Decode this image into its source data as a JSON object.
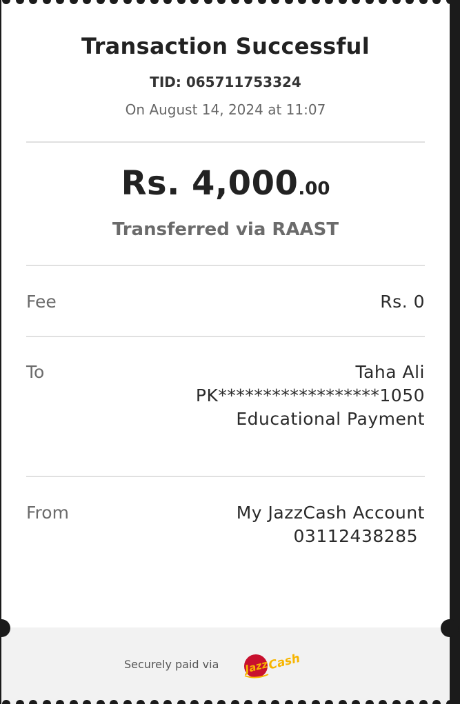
{
  "receipt": {
    "title": "Transaction Successful",
    "tid": "TID: 065711753324",
    "date": "On August 14, 2024 at 11:07",
    "amount_main": "Rs. 4,000",
    "amount_cents": ".00",
    "transfer_method": "Transferred via RAAST"
  },
  "fee": {
    "label": "Fee",
    "value": "Rs. 0"
  },
  "to": {
    "label": "To",
    "name": "Taha Ali",
    "account": "PK******************1050",
    "purpose": "Educational Payment"
  },
  "from": {
    "label": "From",
    "account_name": "My JazzCash Account",
    "number": "03112438285"
  },
  "footer": {
    "secure_text": "Securely paid via",
    "logo_icon": "jazzcash-logo"
  },
  "colors": {
    "background": "#ffffff",
    "footer_background": "#f2f2f2",
    "logo_red": "#c8102e",
    "logo_yellow": "#f7b500"
  }
}
